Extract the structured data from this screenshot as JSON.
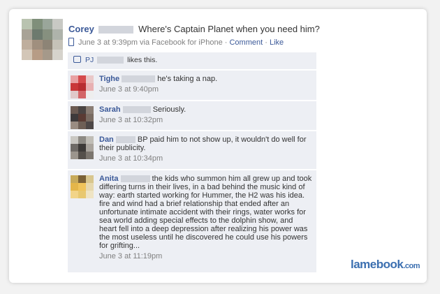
{
  "post": {
    "author": "Corey",
    "message": "Where's Captain Planet when you need him?",
    "time": "June 3 at 9:39pm via Facebook for iPhone",
    "comment_link": "Comment",
    "like_link": "Like",
    "separator": "·"
  },
  "likes": {
    "name_prefix": "PJ",
    "text": "likes this."
  },
  "comments": [
    {
      "author": "Tighe",
      "text": "he's taking a nap.",
      "time": "June 3 at 9:40pm"
    },
    {
      "author": "Sarah",
      "text": "Seriously.",
      "time": "June 3 at 10:32pm"
    },
    {
      "author": "Dan",
      "text": "BP paid him to not show up, it wouldn't do well for their publicity.",
      "time": "June 3 at 10:34pm"
    },
    {
      "author": "Anita",
      "text": "the kids who summon him all grew up and took differing turns in their lives, in a bad behind the music kind of way: earth started working for Hummer, the H2 was his idea. fire and wind had a brief relationship that ended after an unfortunate intimate accident with their rings, water works for sea world adding special effects to the dolphin show, and heart fell into a deep depression after realizing his power was the most useless until he discovered he could use his powers for grifting...",
      "time": "June 3 at 11:19pm"
    }
  ],
  "brand": {
    "name": "lamebook",
    "suffix": ".com"
  }
}
